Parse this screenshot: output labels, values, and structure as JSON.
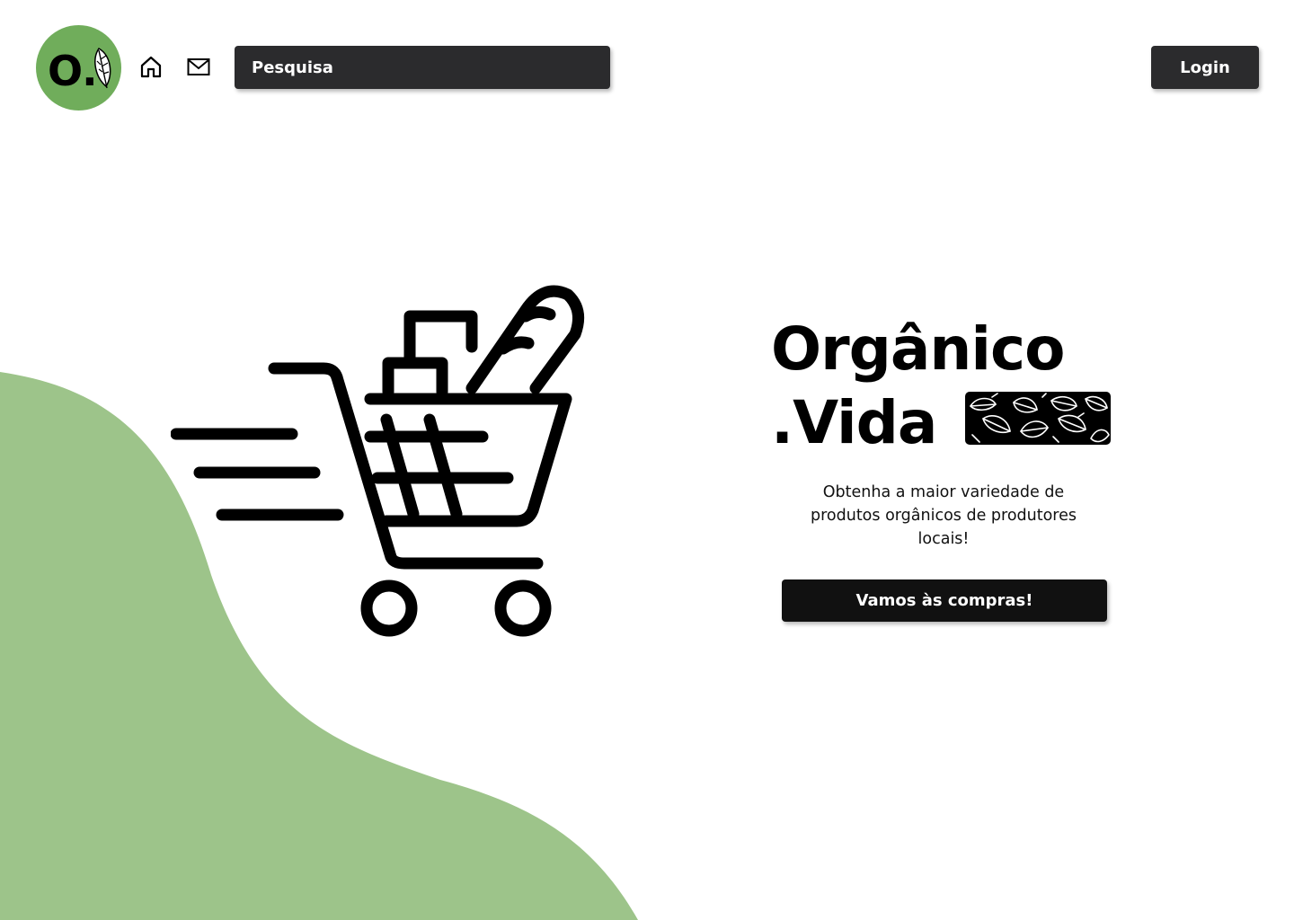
{
  "colors": {
    "accent_green": "#9dc48a",
    "logo_green": "#70ad5b",
    "dark_button": "#2b2b2d",
    "cta_button": "#111111",
    "text": "#000000",
    "background": "#ffffff"
  },
  "header": {
    "logo": {
      "text": "O.",
      "icon": "leaf-icon"
    },
    "nav_icons": [
      "home-icon",
      "mail-icon"
    ],
    "search": {
      "placeholder": "Pesquisa",
      "value": ""
    },
    "login_label": "Login"
  },
  "hero": {
    "illustration_icon": "shopping-cart-icon",
    "title_line1": "Orgânico",
    "title_line2": ".Vida",
    "subtitle": "Obtenha a maior variedade de produtos orgânicos de produtores locais!",
    "cta_label": "Vamos às compras!"
  }
}
